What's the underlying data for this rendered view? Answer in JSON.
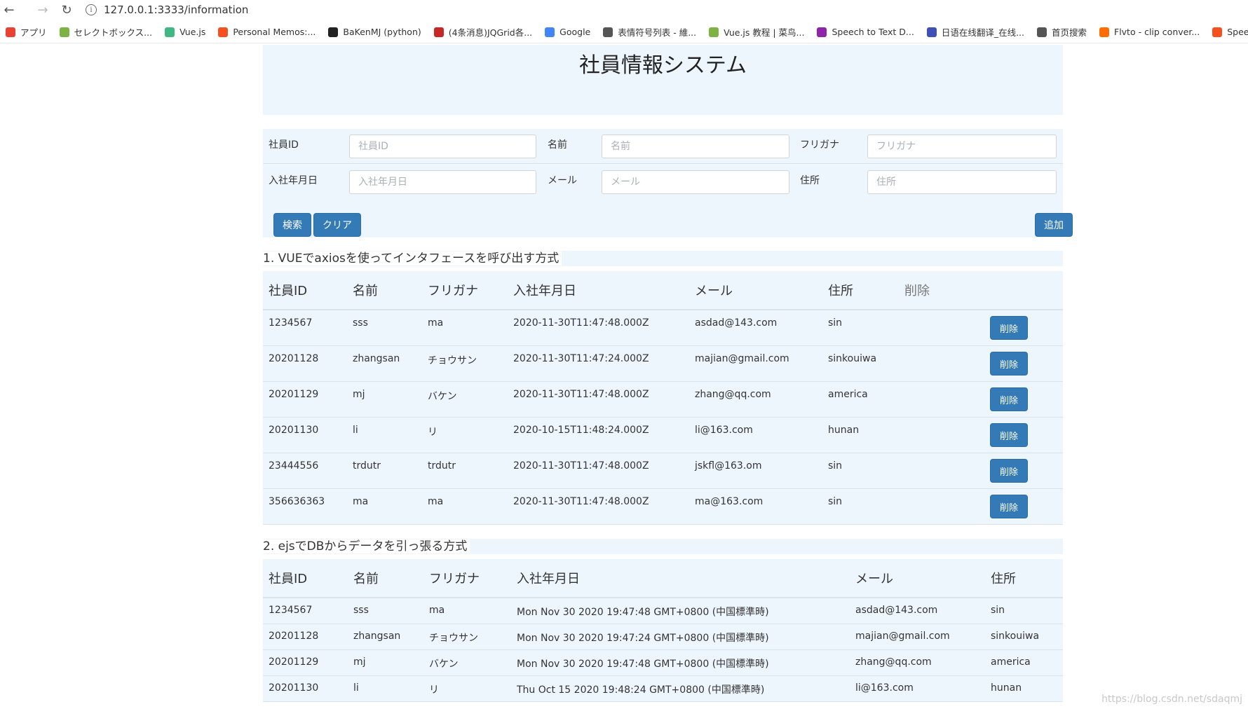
{
  "browser": {
    "url": "127.0.0.1:3333/information",
    "bookmarks": [
      {
        "label": "アプリ",
        "color": "#e94235"
      },
      {
        "label": "セレクトボックス...",
        "color": "#7cb342"
      },
      {
        "label": "Vue.js",
        "color": "#41b883"
      },
      {
        "label": "Personal Memos:...",
        "color": "#f4511e"
      },
      {
        "label": "BaKenMJ (python)",
        "color": "#222222"
      },
      {
        "label": "(4条消息)JQGrid各...",
        "color": "#c62828"
      },
      {
        "label": "Google",
        "color": "#4285f4"
      },
      {
        "label": "表情符号列表 - 維...",
        "color": "#555555"
      },
      {
        "label": "Vue.js 教程 | 菜鸟...",
        "color": "#7cb342"
      },
      {
        "label": "Speech to Text D...",
        "color": "#8e24aa"
      },
      {
        "label": "日语在线翻译_在线...",
        "color": "#3f51b5"
      },
      {
        "label": "首页搜索",
        "color": "#555555"
      },
      {
        "label": "Flvto - clip conver...",
        "color": "#ff6d00"
      },
      {
        "label": "SpeechTe",
        "color": "#f4511e"
      }
    ]
  },
  "page": {
    "title": "社員情報システム"
  },
  "form": {
    "id_label": "社員ID",
    "id_placeholder": "社員ID",
    "name_label": "名前",
    "name_placeholder": "名前",
    "kana_label": "フリガナ",
    "kana_placeholder": "フリガナ",
    "date_label": "入社年月日",
    "date_placeholder": "入社年月日",
    "mail_label": "メール",
    "mail_placeholder": "メール",
    "addr_label": "住所",
    "addr_placeholder": "住所",
    "search_btn": "検索",
    "clear_btn": "クリア",
    "add_btn": "追加"
  },
  "section1": {
    "title": "1.  VUEでaxiosを使ってインタフェースを呼び出す方式",
    "headers": [
      "社員ID",
      "名前",
      "フリガナ",
      "入社年月日",
      "メール",
      "住所",
      "削除"
    ],
    "delete_label": "削除",
    "rows": [
      [
        "1234567",
        "sss",
        "ma",
        "2020-11-30T11:47:48.000Z",
        "asdad@143.com",
        "sin"
      ],
      [
        "20201128",
        "zhangsan",
        "チョウサン",
        "2020-11-30T11:47:24.000Z",
        "majian@gmail.com",
        "sinkouiwa"
      ],
      [
        "20201129",
        "mj",
        "バケン",
        "2020-11-30T11:47:48.000Z",
        "zhang@qq.com",
        "america"
      ],
      [
        "20201130",
        "li",
        "リ",
        "2020-10-15T11:48:24.000Z",
        "li@163.com",
        "hunan"
      ],
      [
        "23444556",
        "trdutr",
        "trdutr",
        "2020-11-30T11:47:48.000Z",
        "jskfl@163.om",
        "sin"
      ],
      [
        "356636363",
        "ma",
        "ma",
        "2020-11-30T11:47:48.000Z",
        "ma@163.com",
        "sin"
      ]
    ]
  },
  "section2": {
    "title": "2.  ejsでDBからデータを引っ張る方式",
    "headers": [
      "社員ID",
      "名前",
      "フリガナ",
      "入社年月日",
      "メール",
      "住所"
    ],
    "rows": [
      [
        "1234567",
        "sss",
        "ma",
        "Mon Nov 30 2020 19:47:48 GMT+0800 (中国標準時)",
        "asdad@143.com",
        "sin"
      ],
      [
        "20201128",
        "zhangsan",
        "チョウサン",
        "Mon Nov 30 2020 19:47:24 GMT+0800 (中国標準時)",
        "majian@gmail.com",
        "sinkouiwa"
      ],
      [
        "20201129",
        "mj",
        "バケン",
        "Mon Nov 30 2020 19:47:48 GMT+0800 (中国標準時)",
        "zhang@qq.com",
        "america"
      ],
      [
        "20201130",
        "li",
        "リ",
        "Thu Oct 15 2020 19:48:24 GMT+0800 (中国標準時)",
        "li@163.com",
        "hunan"
      ]
    ]
  },
  "watermark": "https://blog.csdn.net/sdaqmj"
}
